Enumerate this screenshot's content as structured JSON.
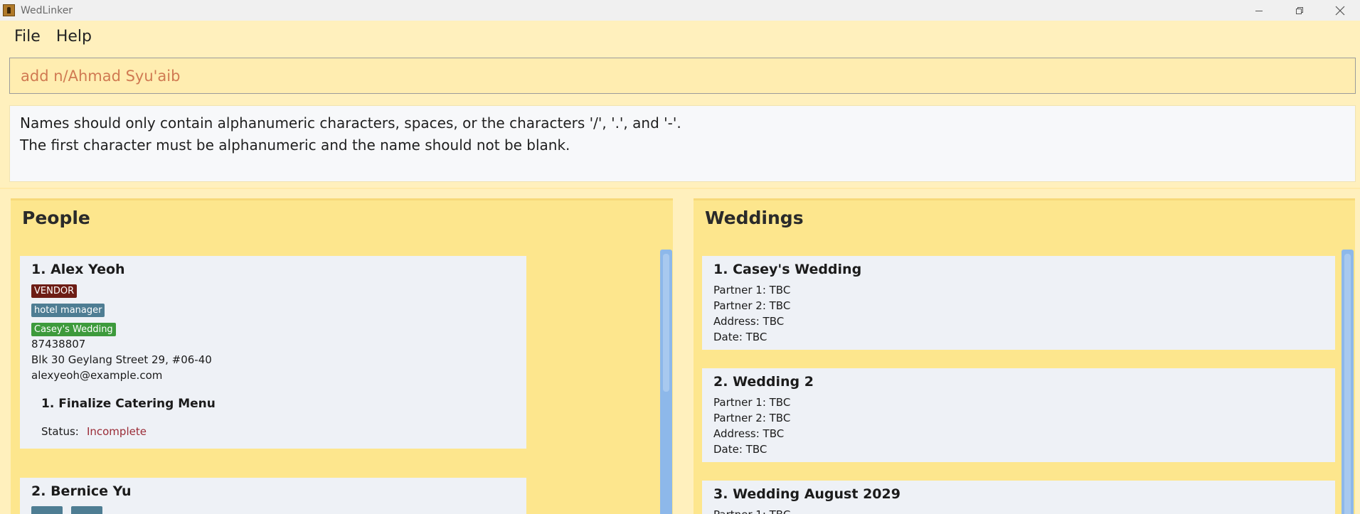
{
  "window": {
    "title": "WedLinker",
    "controls": [
      "minimize-icon",
      "restore-icon",
      "close-icon"
    ]
  },
  "menu": {
    "file": "File",
    "help": "Help"
  },
  "command": {
    "value": "add n/Ahmad Syu'aib"
  },
  "result": {
    "line1": "Names should only contain alphanumeric characters, spaces, or the characters '/', '.', and '-'.",
    "line2": "The first character must be alphanumeric and the name should not be blank."
  },
  "people": {
    "title": "People",
    "items": [
      {
        "index": "1.",
        "name": "Alex Yeoh",
        "tags": {
          "type": "VENDOR",
          "role": "hotel manager",
          "wedding": "Casey's Wedding"
        },
        "phone": "87438807",
        "address": "Blk 30 Geylang Street 29, #06-40",
        "email": "alexyeoh@example.com",
        "task": {
          "index": "1.",
          "name": "Finalize Catering Menu",
          "status_label": "Status:",
          "status": "Incomplete"
        }
      },
      {
        "index": "2.",
        "name": "Bernice Yu"
      }
    ]
  },
  "weddings": {
    "title": "Weddings",
    "items": [
      {
        "index": "1.",
        "name": "Casey's Wedding",
        "partner1": "Partner 1: TBC",
        "partner2": "Partner 2: TBC",
        "address": "Address: TBC",
        "date": "Date: TBC"
      },
      {
        "index": "2.",
        "name": "Wedding 2",
        "partner1": "Partner 1: TBC",
        "partner2": "Partner 2: TBC",
        "address": "Address: TBC",
        "date": "Date: TBC"
      },
      {
        "index": "3.",
        "name": "Wedding August 2029",
        "partner1": "Partner 1: TBC"
      }
    ]
  },
  "colors": {
    "background": "#fff0bd",
    "panel": "#fde68d",
    "card": "#eef1f6",
    "vendor_tag": "#6d1d15",
    "role_tag": "#4e7d93",
    "wedding_tag": "#3d9a3c",
    "status_incomplete": "#9a2b36",
    "scrollbar": "#8db8ea"
  }
}
